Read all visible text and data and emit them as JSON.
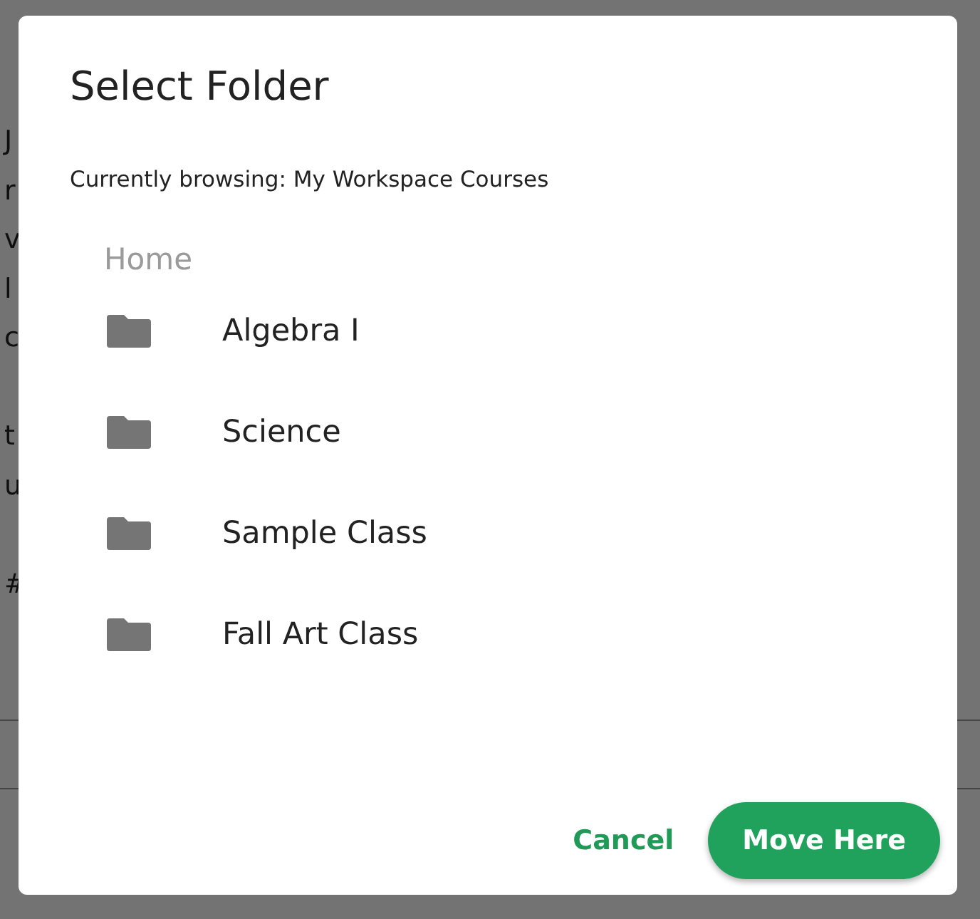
{
  "background_text": [
    [
      "J",
      "r",
      "v",
      "l",
      "c"
    ],
    [
      "t",
      "u"
    ],
    [
      "#"
    ]
  ],
  "dialog": {
    "title": "Select Folder",
    "subtitle": "Currently browsing: My Workspace Courses",
    "breadcrumb": "Home",
    "folders": [
      {
        "name": "Algebra I"
      },
      {
        "name": "Science"
      },
      {
        "name": "Sample Class"
      },
      {
        "name": "Fall Art Class"
      }
    ],
    "buttons": {
      "cancel": "Cancel",
      "confirm": "Move Here"
    }
  }
}
